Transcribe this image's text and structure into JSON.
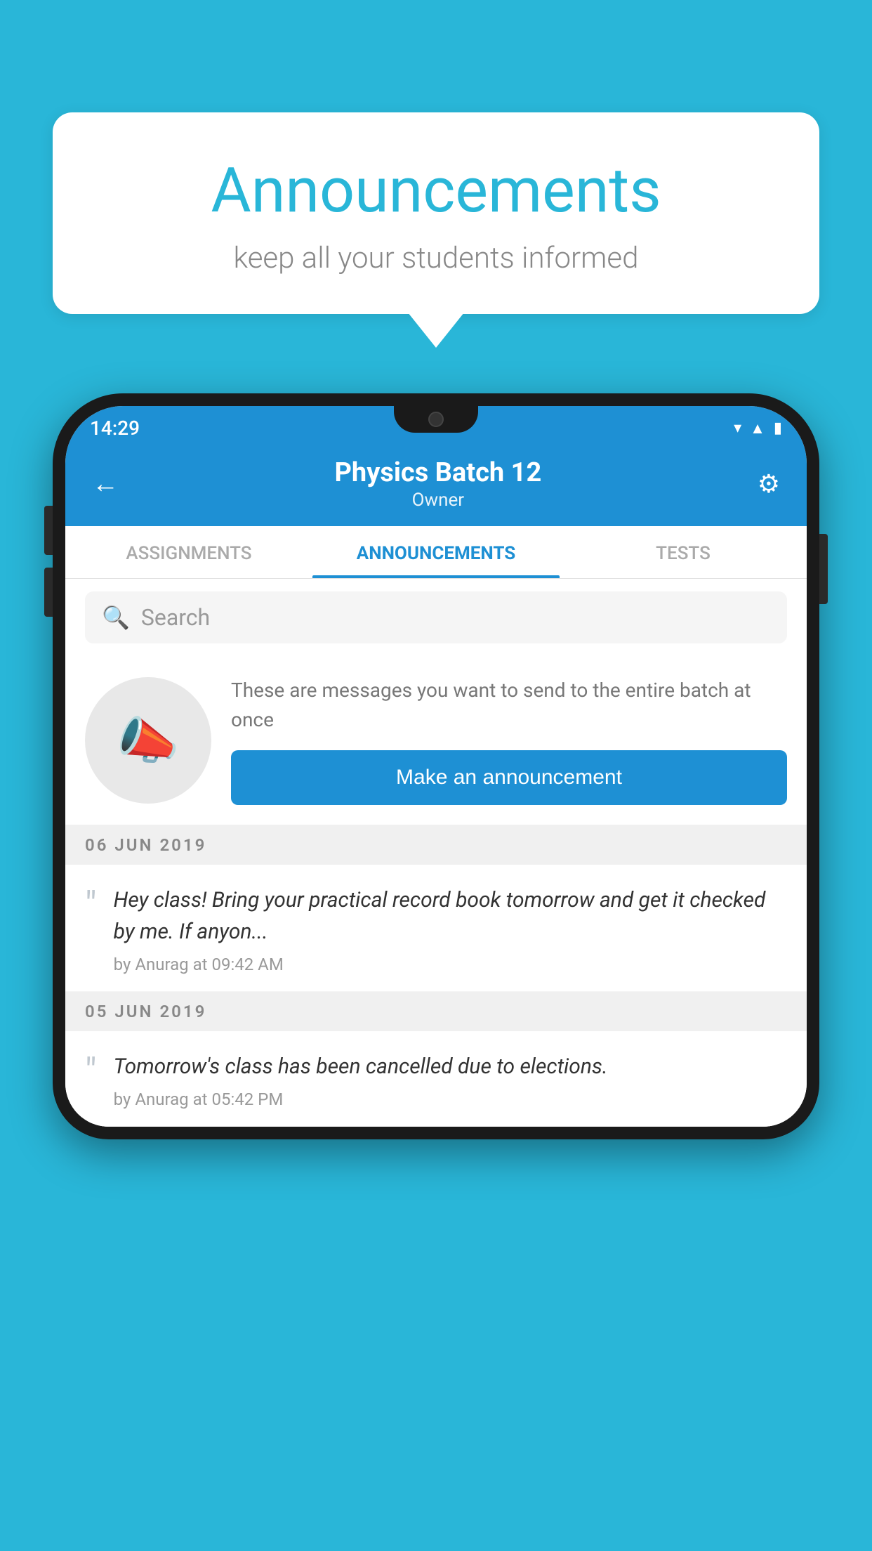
{
  "bubble": {
    "title": "Announcements",
    "subtitle": "keep all your students informed"
  },
  "phone": {
    "status_bar": {
      "time": "14:29"
    },
    "header": {
      "back_icon": "←",
      "title": "Physics Batch 12",
      "subtitle": "Owner",
      "settings_icon": "⚙"
    },
    "tabs": [
      {
        "label": "ASSIGNMENTS",
        "active": false
      },
      {
        "label": "ANNOUNCEMENTS",
        "active": true
      },
      {
        "label": "TESTS",
        "active": false
      }
    ],
    "search": {
      "placeholder": "Search"
    },
    "promo": {
      "description": "These are messages you want to send to the entire batch at once",
      "button_label": "Make an announcement"
    },
    "announcements": [
      {
        "date": "06  JUN  2019",
        "text": "Hey class! Bring your practical record book tomorrow and get it checked by me. If anyon...",
        "meta": "by Anurag at 09:42 AM"
      },
      {
        "date": "05  JUN  2019",
        "text": "Tomorrow's class has been cancelled due to elections.",
        "meta": "by Anurag at 05:42 PM"
      }
    ]
  },
  "colors": {
    "primary_bg": "#29b6d8",
    "header_blue": "#1e90d4",
    "button_blue": "#1e90d4",
    "text_dark": "#333333",
    "text_gray": "#888888"
  }
}
